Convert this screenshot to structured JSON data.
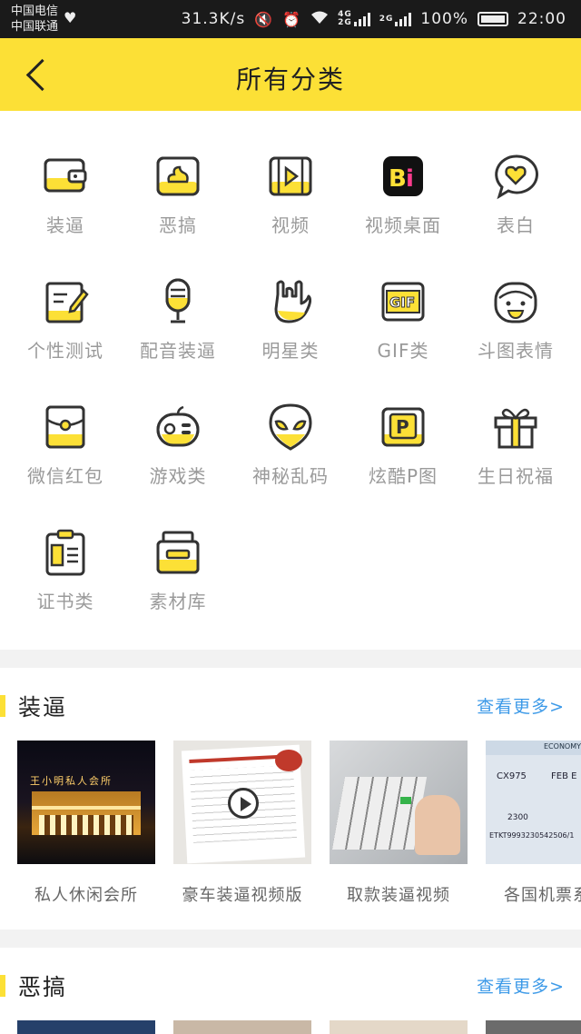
{
  "status_bar": {
    "carrier_1": "中国电信",
    "carrier_2": "中国联通",
    "net_speed": "31.3K/s",
    "net_4g_top": "4G",
    "net_4g_bottom": "2G",
    "net_2g": "2G",
    "battery": "100%",
    "time": "22:00"
  },
  "header": {
    "title": "所有分类"
  },
  "categories": [
    {
      "label": "装逼",
      "icon": "wallet-icon"
    },
    {
      "label": "恶搞",
      "icon": "poop-icon"
    },
    {
      "label": "视频",
      "icon": "video-icon"
    },
    {
      "label": "视频桌面",
      "icon": "bi-icon"
    },
    {
      "label": "表白",
      "icon": "heart-bubble-icon"
    },
    {
      "label": "个性测试",
      "icon": "test-paper-icon"
    },
    {
      "label": "配音装逼",
      "icon": "microphone-icon"
    },
    {
      "label": "明星类",
      "icon": "rock-hand-icon"
    },
    {
      "label": "GIF类",
      "icon": "gif-icon"
    },
    {
      "label": "斗图表情",
      "icon": "face-icon"
    },
    {
      "label": "微信红包",
      "icon": "red-packet-icon"
    },
    {
      "label": "游戏类",
      "icon": "gamepad-icon"
    },
    {
      "label": "神秘乱码",
      "icon": "alien-icon"
    },
    {
      "label": "炫酷P图",
      "icon": "p-icon"
    },
    {
      "label": "生日祝福",
      "icon": "gift-icon"
    },
    {
      "label": "证书类",
      "icon": "certificate-icon"
    },
    {
      "label": "素材库",
      "icon": "material-box-icon"
    }
  ],
  "sections": [
    {
      "title": "装逼",
      "more": "查看更多>",
      "items": [
        {
          "caption": "私人休闲会所"
        },
        {
          "caption": "豪车装逼视频版"
        },
        {
          "caption": "取款装逼视频"
        },
        {
          "caption": "各国机票系"
        }
      ]
    },
    {
      "title": "恶搞",
      "more": "查看更多>",
      "items": []
    }
  ],
  "thumb_text": {
    "club_sign": "王小明私人会所",
    "flight_no": "CX975",
    "flight_date": "FEB E",
    "ticket_no": "ETKT9993230542506/1",
    "fare": "2300",
    "economy": "ECONOMY"
  },
  "colors": {
    "accent": "#fce036",
    "link": "#3d9ae8",
    "text_muted": "#9a9a9a"
  }
}
